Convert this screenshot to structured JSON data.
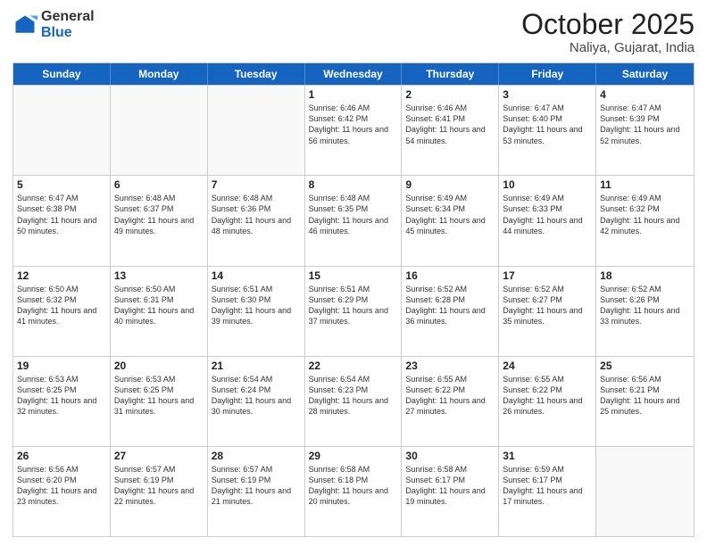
{
  "logo": {
    "general": "General",
    "blue": "Blue"
  },
  "header": {
    "month": "October 2025",
    "location": "Naliya, Gujarat, India"
  },
  "weekdays": [
    "Sunday",
    "Monday",
    "Tuesday",
    "Wednesday",
    "Thursday",
    "Friday",
    "Saturday"
  ],
  "rows": [
    [
      {
        "day": "",
        "sunrise": "",
        "sunset": "",
        "daylight": "",
        "empty": true
      },
      {
        "day": "",
        "sunrise": "",
        "sunset": "",
        "daylight": "",
        "empty": true
      },
      {
        "day": "",
        "sunrise": "",
        "sunset": "",
        "daylight": "",
        "empty": true
      },
      {
        "day": "1",
        "sunrise": "Sunrise: 6:46 AM",
        "sunset": "Sunset: 6:42 PM",
        "daylight": "Daylight: 11 hours and 56 minutes."
      },
      {
        "day": "2",
        "sunrise": "Sunrise: 6:46 AM",
        "sunset": "Sunset: 6:41 PM",
        "daylight": "Daylight: 11 hours and 54 minutes."
      },
      {
        "day": "3",
        "sunrise": "Sunrise: 6:47 AM",
        "sunset": "Sunset: 6:40 PM",
        "daylight": "Daylight: 11 hours and 53 minutes."
      },
      {
        "day": "4",
        "sunrise": "Sunrise: 6:47 AM",
        "sunset": "Sunset: 6:39 PM",
        "daylight": "Daylight: 11 hours and 52 minutes."
      }
    ],
    [
      {
        "day": "5",
        "sunrise": "Sunrise: 6:47 AM",
        "sunset": "Sunset: 6:38 PM",
        "daylight": "Daylight: 11 hours and 50 minutes."
      },
      {
        "day": "6",
        "sunrise": "Sunrise: 6:48 AM",
        "sunset": "Sunset: 6:37 PM",
        "daylight": "Daylight: 11 hours and 49 minutes."
      },
      {
        "day": "7",
        "sunrise": "Sunrise: 6:48 AM",
        "sunset": "Sunset: 6:36 PM",
        "daylight": "Daylight: 11 hours and 48 minutes."
      },
      {
        "day": "8",
        "sunrise": "Sunrise: 6:48 AM",
        "sunset": "Sunset: 6:35 PM",
        "daylight": "Daylight: 11 hours and 46 minutes."
      },
      {
        "day": "9",
        "sunrise": "Sunrise: 6:49 AM",
        "sunset": "Sunset: 6:34 PM",
        "daylight": "Daylight: 11 hours and 45 minutes."
      },
      {
        "day": "10",
        "sunrise": "Sunrise: 6:49 AM",
        "sunset": "Sunset: 6:33 PM",
        "daylight": "Daylight: 11 hours and 44 minutes."
      },
      {
        "day": "11",
        "sunrise": "Sunrise: 6:49 AM",
        "sunset": "Sunset: 6:32 PM",
        "daylight": "Daylight: 11 hours and 42 minutes."
      }
    ],
    [
      {
        "day": "12",
        "sunrise": "Sunrise: 6:50 AM",
        "sunset": "Sunset: 6:32 PM",
        "daylight": "Daylight: 11 hours and 41 minutes."
      },
      {
        "day": "13",
        "sunrise": "Sunrise: 6:50 AM",
        "sunset": "Sunset: 6:31 PM",
        "daylight": "Daylight: 11 hours and 40 minutes."
      },
      {
        "day": "14",
        "sunrise": "Sunrise: 6:51 AM",
        "sunset": "Sunset: 6:30 PM",
        "daylight": "Daylight: 11 hours and 39 minutes."
      },
      {
        "day": "15",
        "sunrise": "Sunrise: 6:51 AM",
        "sunset": "Sunset: 6:29 PM",
        "daylight": "Daylight: 11 hours and 37 minutes."
      },
      {
        "day": "16",
        "sunrise": "Sunrise: 6:52 AM",
        "sunset": "Sunset: 6:28 PM",
        "daylight": "Daylight: 11 hours and 36 minutes."
      },
      {
        "day": "17",
        "sunrise": "Sunrise: 6:52 AM",
        "sunset": "Sunset: 6:27 PM",
        "daylight": "Daylight: 11 hours and 35 minutes."
      },
      {
        "day": "18",
        "sunrise": "Sunrise: 6:52 AM",
        "sunset": "Sunset: 6:26 PM",
        "daylight": "Daylight: 11 hours and 33 minutes."
      }
    ],
    [
      {
        "day": "19",
        "sunrise": "Sunrise: 6:53 AM",
        "sunset": "Sunset: 6:25 PM",
        "daylight": "Daylight: 11 hours and 32 minutes."
      },
      {
        "day": "20",
        "sunrise": "Sunrise: 6:53 AM",
        "sunset": "Sunset: 6:25 PM",
        "daylight": "Daylight: 11 hours and 31 minutes."
      },
      {
        "day": "21",
        "sunrise": "Sunrise: 6:54 AM",
        "sunset": "Sunset: 6:24 PM",
        "daylight": "Daylight: 11 hours and 30 minutes."
      },
      {
        "day": "22",
        "sunrise": "Sunrise: 6:54 AM",
        "sunset": "Sunset: 6:23 PM",
        "daylight": "Daylight: 11 hours and 28 minutes."
      },
      {
        "day": "23",
        "sunrise": "Sunrise: 6:55 AM",
        "sunset": "Sunset: 6:22 PM",
        "daylight": "Daylight: 11 hours and 27 minutes."
      },
      {
        "day": "24",
        "sunrise": "Sunrise: 6:55 AM",
        "sunset": "Sunset: 6:22 PM",
        "daylight": "Daylight: 11 hours and 26 minutes."
      },
      {
        "day": "25",
        "sunrise": "Sunrise: 6:56 AM",
        "sunset": "Sunset: 6:21 PM",
        "daylight": "Daylight: 11 hours and 25 minutes."
      }
    ],
    [
      {
        "day": "26",
        "sunrise": "Sunrise: 6:56 AM",
        "sunset": "Sunset: 6:20 PM",
        "daylight": "Daylight: 11 hours and 23 minutes."
      },
      {
        "day": "27",
        "sunrise": "Sunrise: 6:57 AM",
        "sunset": "Sunset: 6:19 PM",
        "daylight": "Daylight: 11 hours and 22 minutes."
      },
      {
        "day": "28",
        "sunrise": "Sunrise: 6:57 AM",
        "sunset": "Sunset: 6:19 PM",
        "daylight": "Daylight: 11 hours and 21 minutes."
      },
      {
        "day": "29",
        "sunrise": "Sunrise: 6:58 AM",
        "sunset": "Sunset: 6:18 PM",
        "daylight": "Daylight: 11 hours and 20 minutes."
      },
      {
        "day": "30",
        "sunrise": "Sunrise: 6:58 AM",
        "sunset": "Sunset: 6:17 PM",
        "daylight": "Daylight: 11 hours and 19 minutes."
      },
      {
        "day": "31",
        "sunrise": "Sunrise: 6:59 AM",
        "sunset": "Sunset: 6:17 PM",
        "daylight": "Daylight: 11 hours and 17 minutes."
      },
      {
        "day": "",
        "sunrise": "",
        "sunset": "",
        "daylight": "",
        "empty": true
      }
    ]
  ]
}
